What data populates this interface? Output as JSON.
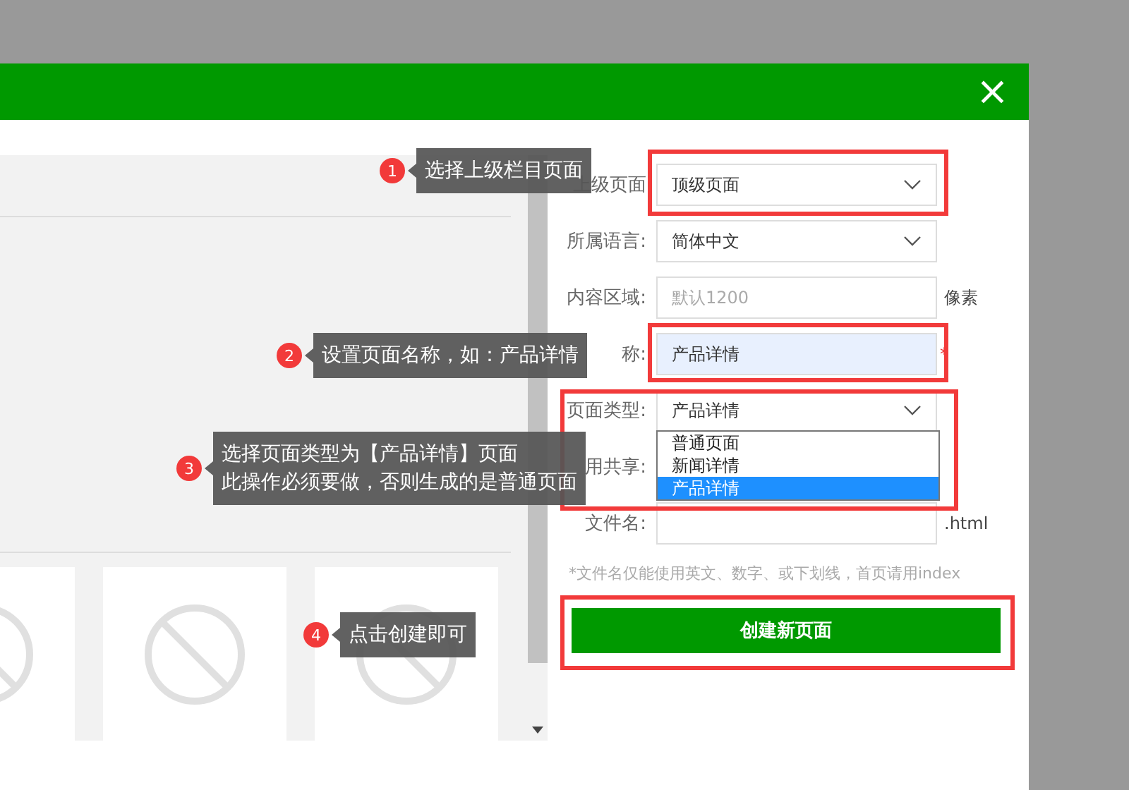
{
  "dialog": {
    "close": "×"
  },
  "form": {
    "fields": [
      {
        "kind": "select",
        "label": "上级页面",
        "value": "顶级页面"
      },
      {
        "kind": "select",
        "label": "所属语言:",
        "value": "简体中文"
      },
      {
        "kind": "input",
        "label": "内容区域:",
        "placeholder": "默认1200",
        "suffix": "像素"
      },
      {
        "kind": "input",
        "label": "称:",
        "value": "产品详情",
        "required_mark": "*",
        "focused": true
      },
      {
        "kind": "select",
        "label": "页面类型:",
        "value": "产品详情",
        "expanded": true,
        "options": [
          {
            "label": "普通页面",
            "selected": false
          },
          {
            "label": "新闻详情",
            "selected": false
          },
          {
            "label": "产品详情",
            "selected": true
          }
        ]
      },
      {
        "kind": "hidden",
        "label": "用共享:"
      },
      {
        "kind": "input",
        "label": "文件名:",
        "suffix": ".html"
      }
    ],
    "hint": "*文件名仅能使用英文、数字、或下划线，首页请用index",
    "submit": "创建新页面"
  },
  "callouts": [
    {
      "number": "1",
      "lines": [
        "选择上级栏目页面"
      ]
    },
    {
      "number": "2",
      "lines": [
        "设置页面名称，如：产品详情"
      ]
    },
    {
      "number": "3",
      "lines": [
        "选择页面类型为【产品详情】页面",
        "此操作必须要做，否则生成的是普通页面"
      ]
    },
    {
      "number": "4",
      "lines": [
        "点击创建即可"
      ]
    }
  ]
}
